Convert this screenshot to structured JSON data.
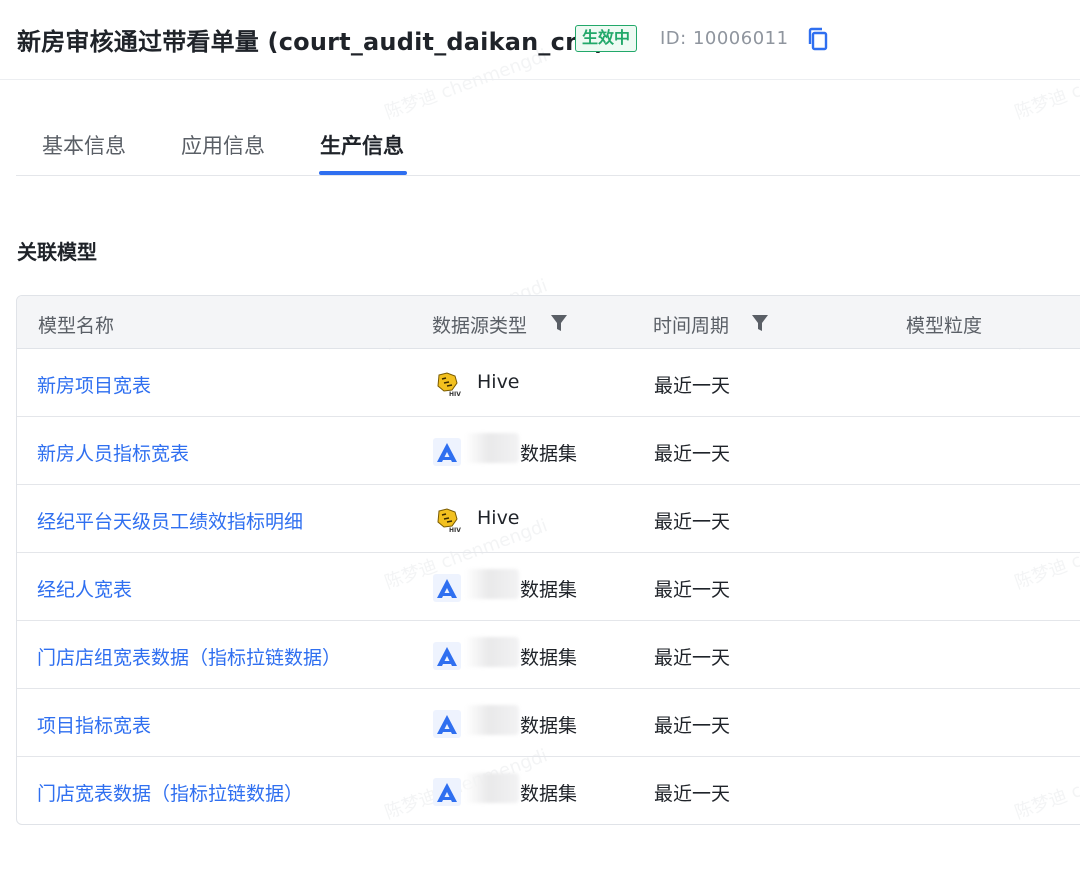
{
  "header": {
    "title": "新房审核通过带看单量 (court_audit_daikan_cnt)",
    "status": "生效中",
    "id_text": "ID:  10006011",
    "copy_icon": "copy-icon"
  },
  "tabs": [
    {
      "label": "基本信息",
      "active": false
    },
    {
      "label": "应用信息",
      "active": false
    },
    {
      "label": "生产信息",
      "active": true
    }
  ],
  "section": {
    "title": "关联模型"
  },
  "table": {
    "columns": {
      "name": "模型名称",
      "source_type": "数据源类型",
      "period": "时间周期",
      "granularity": "模型粒度"
    },
    "rows": [
      {
        "name": "新房项目宽表",
        "source_icon": "hive-icon",
        "source": "Hive",
        "period": "最近一天"
      },
      {
        "name": "新房人员指标宽表",
        "source_icon": "dataset-icon",
        "source": "数据集",
        "period": "最近一天"
      },
      {
        "name": "经纪平台天级员工绩效指标明细",
        "source_icon": "hive-icon",
        "source": "Hive",
        "period": "最近一天"
      },
      {
        "name": "经纪人宽表",
        "source_icon": "dataset-icon",
        "source": "数据集",
        "period": "最近一天"
      },
      {
        "name": "门店店组宽表数据（指标拉链数据）",
        "source_icon": "dataset-icon",
        "source": "数据集",
        "period": "最近一天"
      },
      {
        "name": "项目指标宽表",
        "source_icon": "dataset-icon",
        "source": "数据集",
        "period": "最近一天"
      },
      {
        "name": "门店宽表数据（指标拉链数据）",
        "source_icon": "dataset-icon",
        "source": "数据集",
        "period": "最近一天"
      }
    ]
  },
  "watermark": {
    "text": "陈梦迪 chenmengdi"
  },
  "colors": {
    "accent": "#2f6ff0",
    "status_green": "#22a86a",
    "header_bg": "#f4f5f7"
  }
}
